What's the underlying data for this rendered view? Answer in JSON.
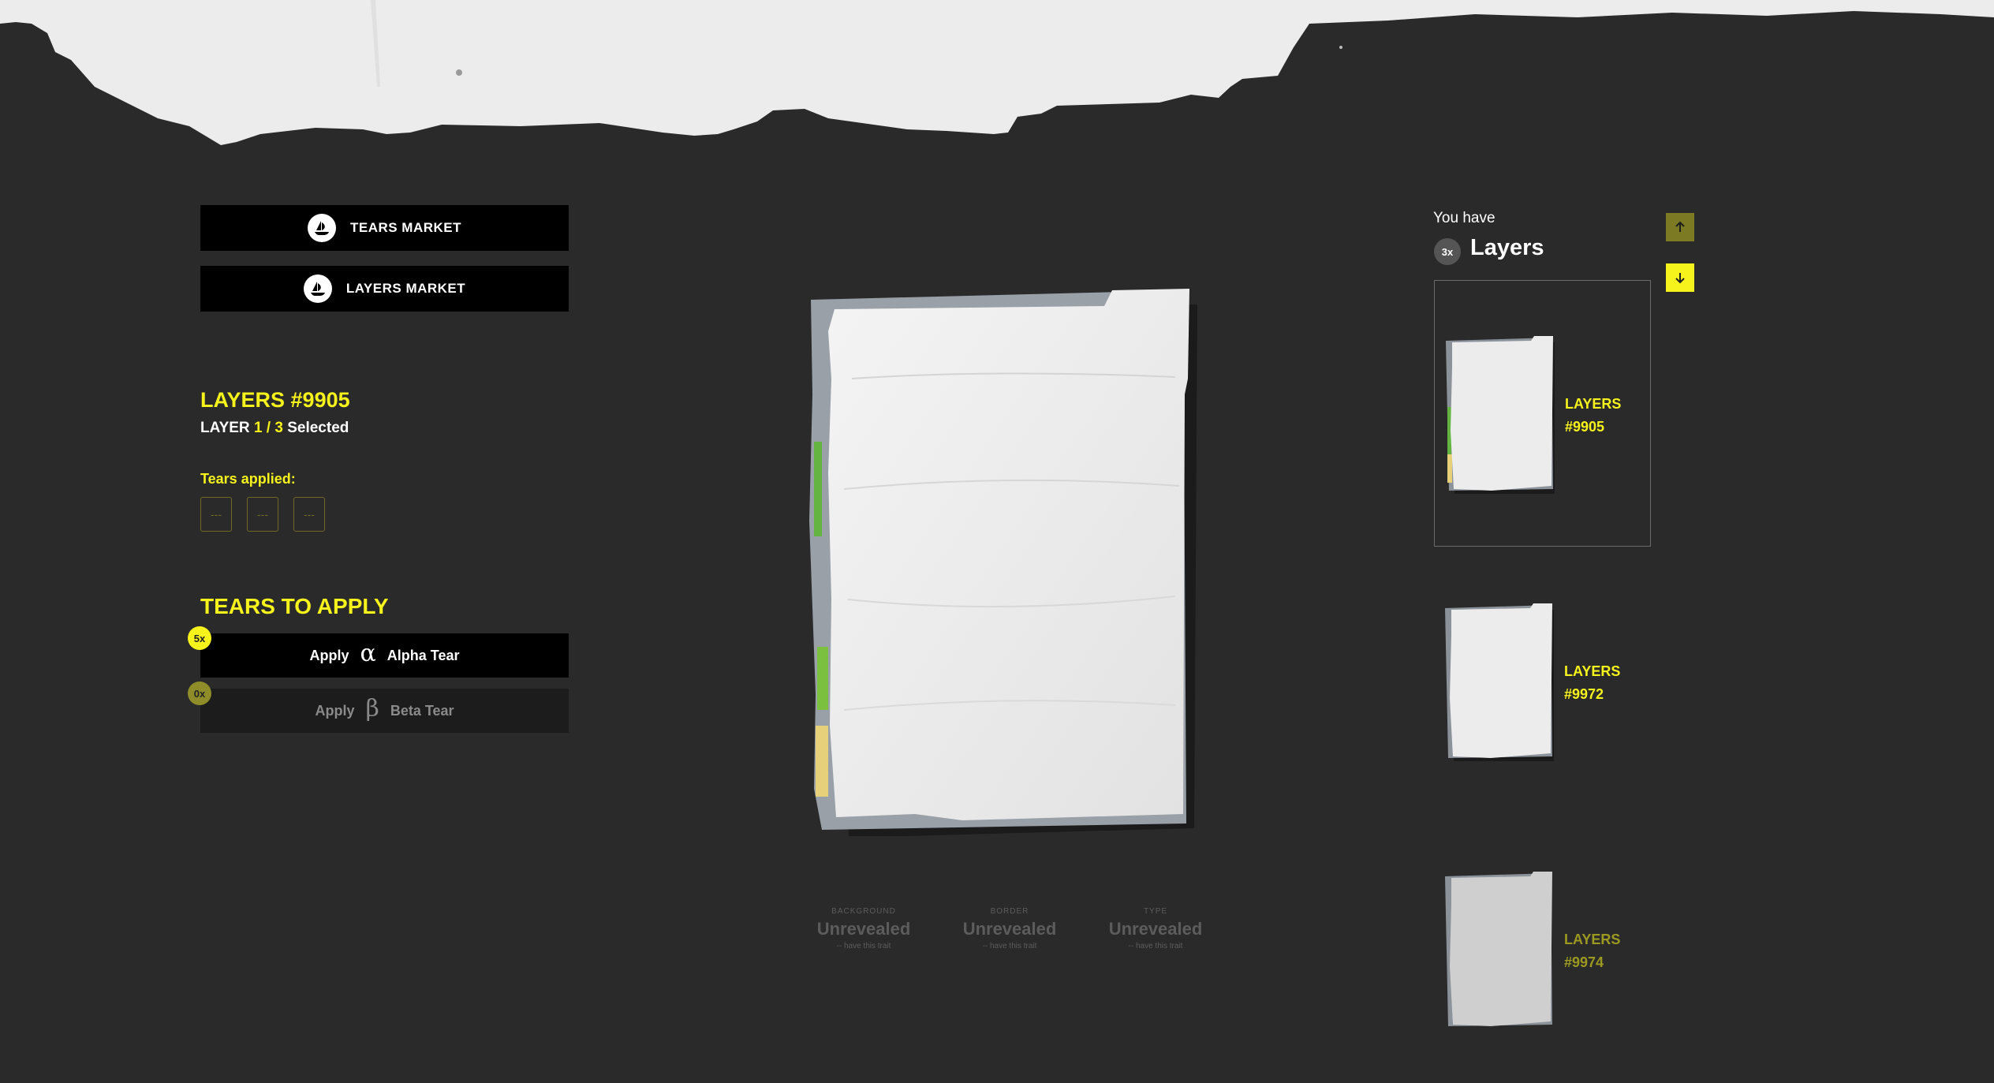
{
  "header": {
    "decor": "torn-paper-banner"
  },
  "markets": [
    {
      "label": "TEARS MARKET",
      "icon": "opensea-icon"
    },
    {
      "label": "LAYERS MARKET",
      "icon": "opensea-icon"
    }
  ],
  "layer": {
    "title": "LAYERS #9905",
    "prefix": "LAYER",
    "current": "1",
    "sep": "/",
    "total": "3",
    "suffix": "Selected"
  },
  "tears_applied": {
    "label": "Tears applied:",
    "slots": [
      "---",
      "---",
      "---"
    ]
  },
  "tears_to_apply": {
    "title": "TEARS TO APPLY",
    "alpha": {
      "count": "5x",
      "apply": "Apply",
      "glyph": "α",
      "name": "Alpha Tear"
    },
    "beta": {
      "count": "0x",
      "apply": "Apply",
      "glyph": "β",
      "name": "Beta Tear"
    }
  },
  "traits": [
    {
      "label": "BACKGROUND",
      "value": "Unrevealed",
      "note": "-- have this trait"
    },
    {
      "label": "BORDER",
      "value": "Unrevealed",
      "note": "-- have this trait"
    },
    {
      "label": "TYPE",
      "value": "Unrevealed",
      "note": "-- have this trait"
    }
  ],
  "collection": {
    "you_have": "You have",
    "count": "3x",
    "title": "Layers",
    "items": [
      {
        "line1": "LAYERS",
        "line2": "#9905",
        "selected": true
      },
      {
        "line1": "LAYERS",
        "line2": "#9972",
        "selected": false
      },
      {
        "line1": "LAYERS",
        "line2": "#9974",
        "selected": false
      }
    ]
  },
  "colors": {
    "accent": "#f6f21b",
    "background": "#2a2a2a",
    "button": "#000000",
    "paper": "#ebebeb"
  }
}
